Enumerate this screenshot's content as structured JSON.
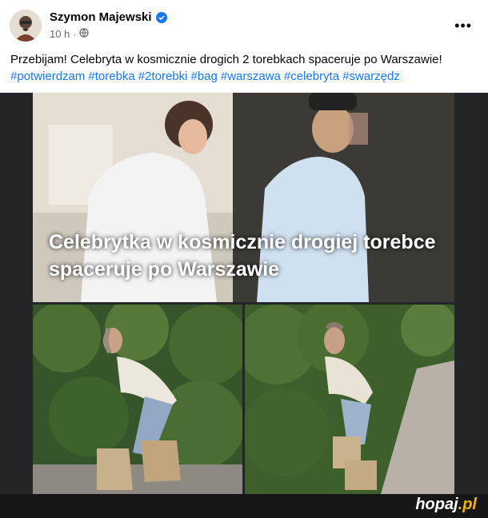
{
  "post": {
    "author": "Szymon Majewski",
    "time": "10 h",
    "text": "Przebijam! Celebryta w kosmicznie drogich 2 torebkach spaceruje po Warszawie!",
    "hashtags": [
      "#potwierdzam",
      "#torebka",
      "#2torebki",
      "#bag",
      "#warszawa",
      "#celebryta",
      "#swarzędz"
    ]
  },
  "media": {
    "banner_caption": "Celebrytka w kosmicznie drogiej torebce spaceruje po Warszawie"
  },
  "footer": {
    "watermark": "hopaj",
    "watermark_suffix": ".pl"
  },
  "icons": {
    "verified": "verified-badge-icon",
    "audience": "globe-icon",
    "more": "more-options-icon"
  },
  "colors": {
    "link": "#1877f2",
    "meta": "#65676b",
    "media_bg": "#242526",
    "watermark_accent": "#f5b400"
  }
}
